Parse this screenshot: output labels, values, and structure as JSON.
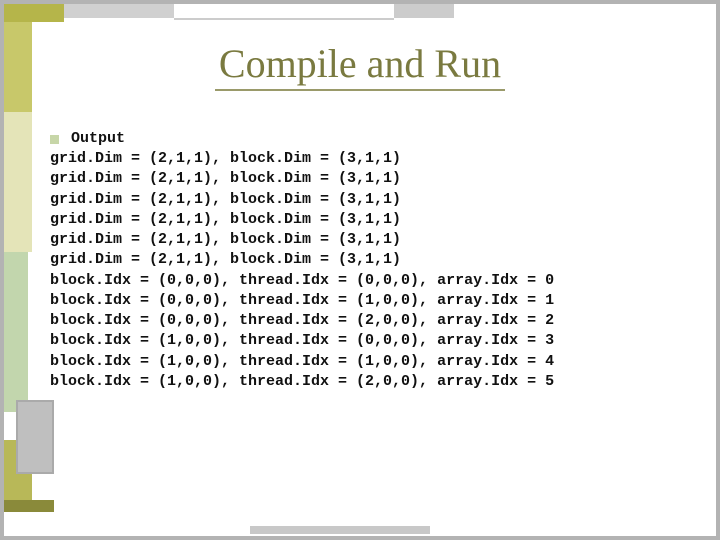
{
  "title": "Compile and Run",
  "bullet_label": "Output",
  "lines": [
    "grid.Dim = (2,1,1), block.Dim = (3,1,1)",
    "grid.Dim = (2,1,1), block.Dim = (3,1,1)",
    "grid.Dim = (2,1,1), block.Dim = (3,1,1)",
    "grid.Dim = (2,1,1), block.Dim = (3,1,1)",
    "grid.Dim = (2,1,1), block.Dim = (3,1,1)",
    "grid.Dim = (2,1,1), block.Dim = (3,1,1)",
    "block.Idx = (0,0,0), thread.Idx = (0,0,0), array.Idx = 0",
    "block.Idx = (0,0,0), thread.Idx = (1,0,0), array.Idx = 1",
    "block.Idx = (0,0,0), thread.Idx = (2,0,0), array.Idx = 2",
    "block.Idx = (1,0,0), thread.Idx = (0,0,0), array.Idx = 3",
    "block.Idx = (1,0,0), thread.Idx = (1,0,0), array.Idx = 4",
    "block.Idx = (1,0,0), thread.Idx = (2,0,0), array.Idx = 5"
  ]
}
